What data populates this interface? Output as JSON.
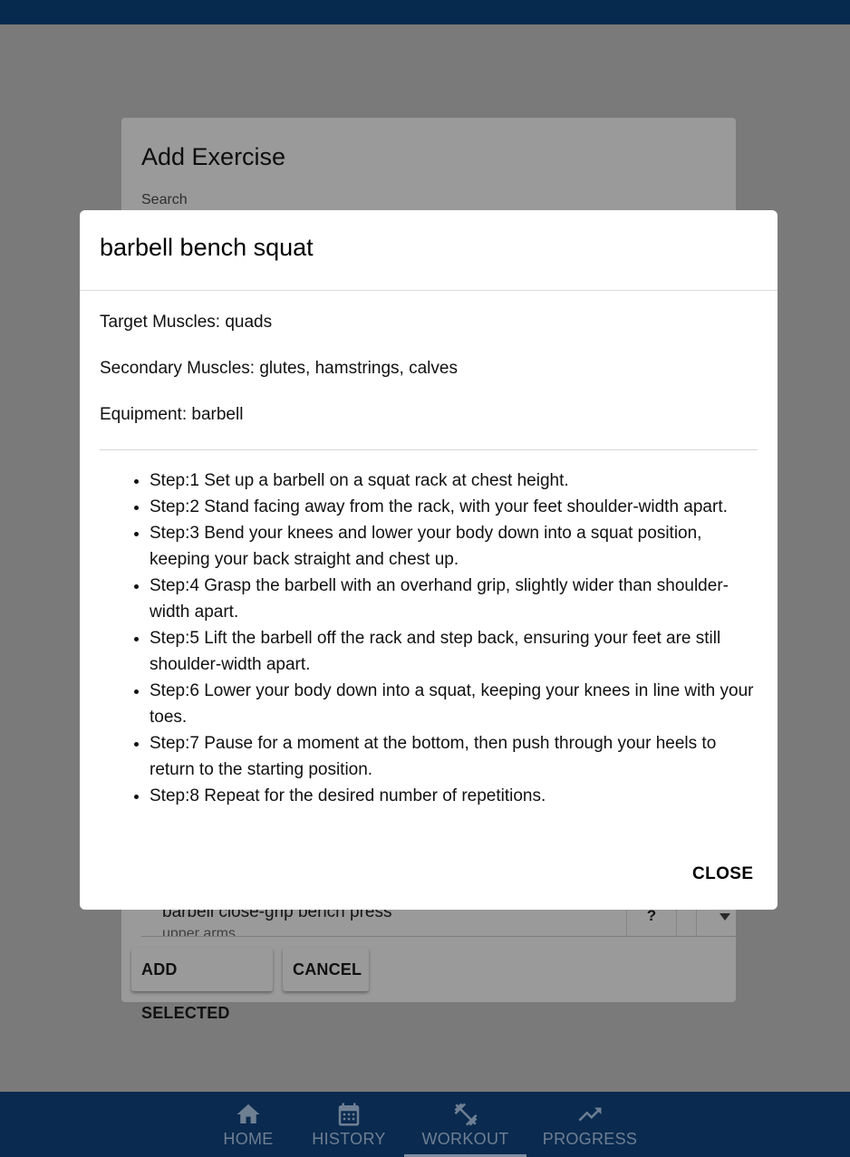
{
  "add_dialog": {
    "title": "Add Exercise",
    "search_label": "Search",
    "exercise_row": {
      "name": "barbell close-grip bench press",
      "subtitle": "upper arms",
      "help_label": "?"
    },
    "add_selected_label": "ADD SELECTED",
    "cancel_label": "CANCEL"
  },
  "modal": {
    "title": "barbell bench squat",
    "target_muscles": "Target Muscles: quads",
    "secondary_muscles": "Secondary Muscles: glutes, hamstrings, calves",
    "equipment": "Equipment: barbell",
    "steps": [
      "Step:1 Set up a barbell on a squat rack at chest height.",
      "Step:2 Stand facing away from the rack, with your feet shoulder-width apart.",
      "Step:3 Bend your knees and lower your body down into a squat position, keeping your back straight and chest up.",
      "Step:4 Grasp the barbell with an overhand grip, slightly wider than shoulder-width apart.",
      "Step:5 Lift the barbell off the rack and step back, ensuring your feet are still shoulder-width apart.",
      "Step:6 Lower your body down into a squat, keeping your knees in line with your toes.",
      "Step:7 Pause for a moment at the bottom, then push through your heels to return to the starting position.",
      "Step:8 Repeat for the desired number of repetitions."
    ],
    "close_label": "CLOSE"
  },
  "bottom_nav": {
    "items": [
      {
        "label": "HOME",
        "icon": "home-icon"
      },
      {
        "label": "HISTORY",
        "icon": "calendar-icon"
      },
      {
        "label": "WORKOUT",
        "icon": "dumbbell-icon",
        "active": true
      },
      {
        "label": "PROGRESS",
        "icon": "trending-up-icon"
      }
    ]
  },
  "colors": {
    "top_bar": "#06294e",
    "bottom_nav": "#0a2a4f",
    "nav_inactive": "#6f7f93",
    "backdrop": "#7a7a7a"
  }
}
